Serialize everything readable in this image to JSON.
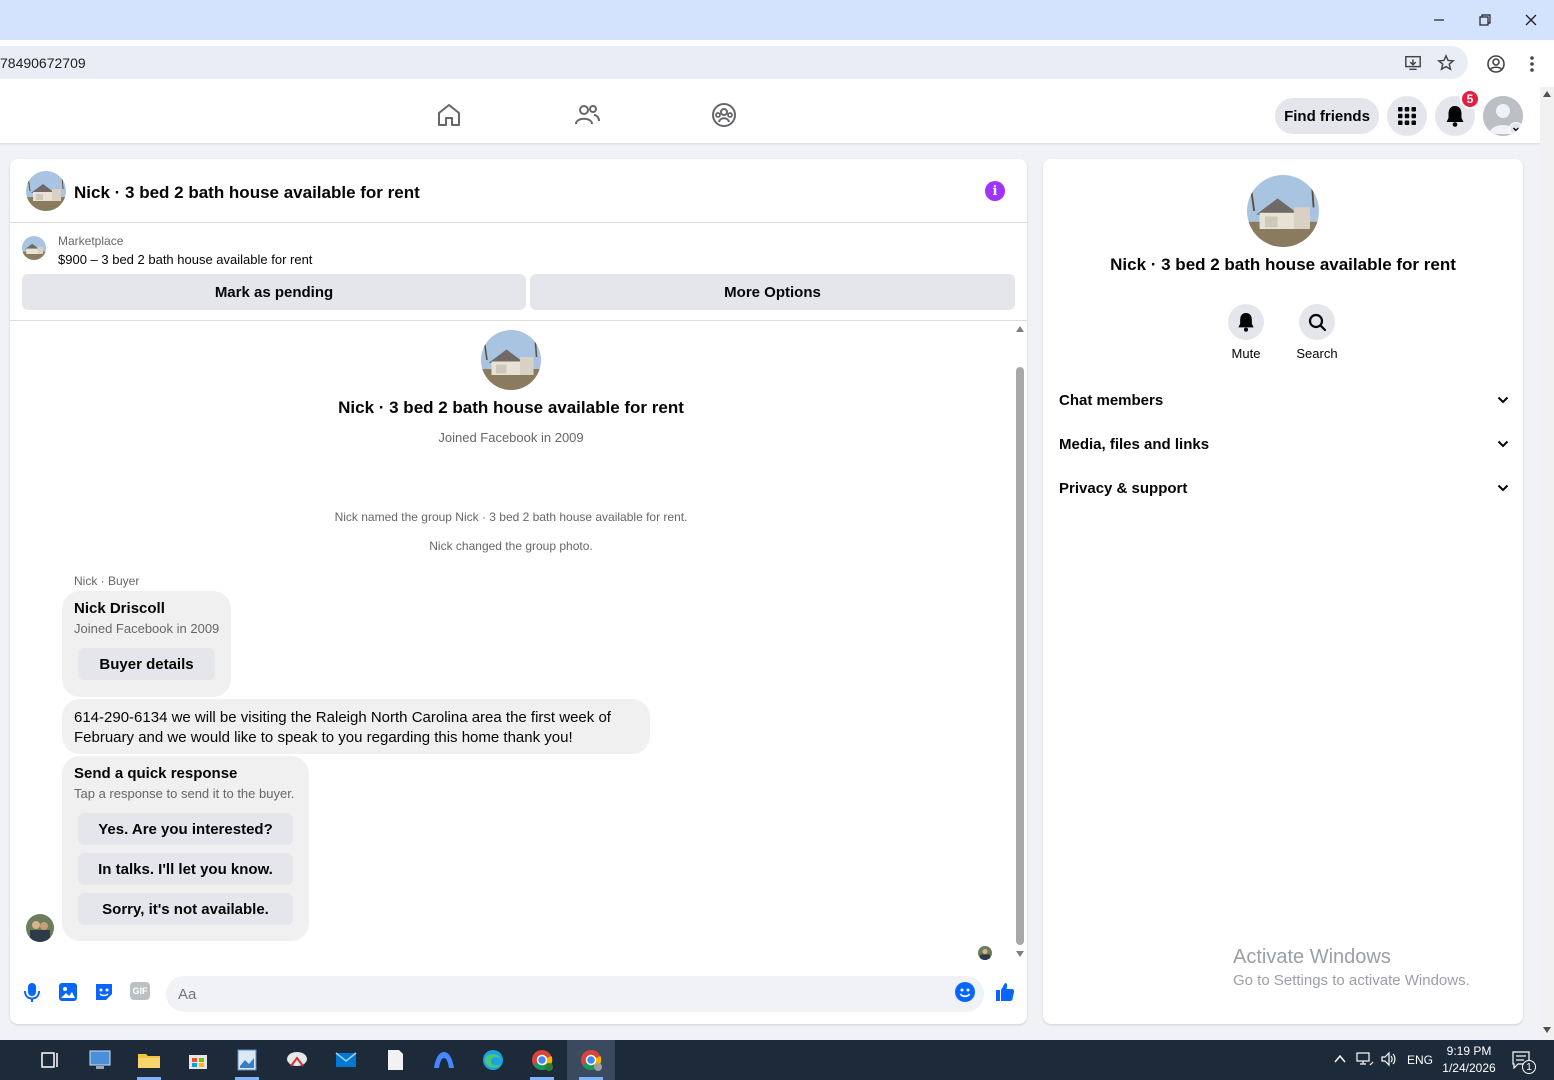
{
  "browser": {
    "url_fragment": "78490672709"
  },
  "nav": {
    "find_friends": "Find friends",
    "notification_count": "5"
  },
  "chat": {
    "header_title": "Nick · 3 bed 2 bath house available for rent",
    "marketplace_label": "Marketplace",
    "listing_title": "$900 – 3 bed 2 bath house available for rent",
    "mark_pending": "Mark as pending",
    "more_options": "More Options",
    "intro_title": "Nick · 3 bed 2 bath house available for rent",
    "intro_subtitle": "Joined Facebook in 2009",
    "event_1": "Nick named the group Nick · 3 bed 2 bath house available for rent.",
    "event_2": "Nick changed the group photo.",
    "sender_label": "Nick · Buyer",
    "buyer_card": {
      "name": "Nick Driscoll",
      "joined": "Joined Facebook in 2009",
      "button": "Buyer details"
    },
    "message_line_1": "614-290-6134 we will be visiting the Raleigh North Carolina area the first week of",
    "message_line_2": "February and we would like to speak to you regarding this home thank you!",
    "quick_response": {
      "title": "Send a quick response",
      "subtitle": "Tap a response to send it to the buyer.",
      "options": [
        "Yes. Are you interested?",
        "In talks. I'll let you know.",
        "Sorry, it's not available."
      ]
    },
    "composer_placeholder": "Aa",
    "gif_label": "GIF"
  },
  "info_panel": {
    "title": "Nick · 3 bed 2 bath house available for rent",
    "mute": "Mute",
    "search": "Search",
    "sections": [
      "Chat members",
      "Media, files and links",
      "Privacy & support"
    ]
  },
  "watermark": {
    "line1": "Activate Windows",
    "line2": "Go to Settings to activate Windows."
  },
  "taskbar": {
    "language": "ENG",
    "time": "9:19 PM",
    "date": "1/24/2026",
    "notification_count": "1"
  },
  "colors": {
    "facebook_blue": "#0866ff",
    "info_purple": "#a033ff",
    "badge_red": "#e41e3f"
  }
}
